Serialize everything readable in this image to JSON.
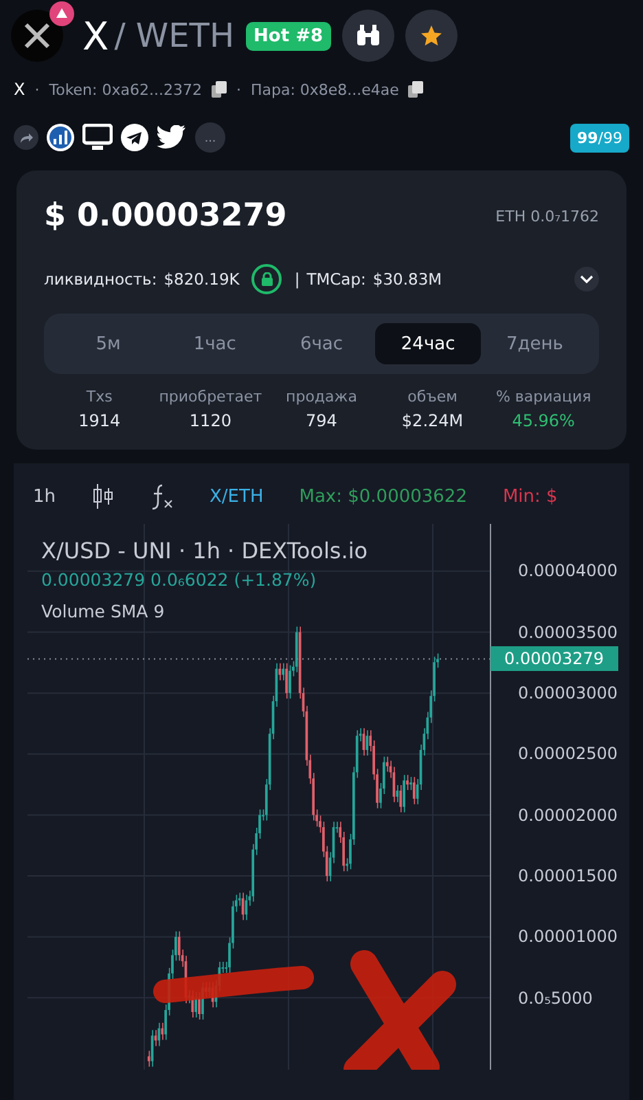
{
  "header": {
    "base": "X",
    "quote": "/ WETH",
    "hot": "Hot #8"
  },
  "addresses": {
    "symbol": "X",
    "dot": "·",
    "token": "Token: 0xa62...2372",
    "pair": "Пара: 0x8e8...e4ae"
  },
  "links": {
    "more": "...",
    "score": "99",
    "score_total": "/99"
  },
  "price": {
    "usd": "$ 0.00003279",
    "eth": "ETH 0.0₇1762"
  },
  "liquidity": {
    "label": "ликвидность:",
    "value": "$820.19K",
    "locked": true,
    "separator": "|",
    "mcap_label": "TMCap:",
    "mcap_value": "$30.83M"
  },
  "tabs": [
    {
      "label": "5м",
      "selected": false
    },
    {
      "label": "1час",
      "selected": false
    },
    {
      "label": "6час",
      "selected": false
    },
    {
      "label": "24час",
      "selected": true
    },
    {
      "label": "7день",
      "selected": false
    }
  ],
  "stats": [
    {
      "label": "Txs",
      "value": "1914",
      "color": "#e6e8ee"
    },
    {
      "label": "приобретает",
      "value": "1120",
      "color": "#e6e8ee"
    },
    {
      "label": "продажа",
      "value": "794",
      "color": "#e6e8ee"
    },
    {
      "label": "объем",
      "value": "$2.24M",
      "color": "#e6e8ee"
    },
    {
      "label": "% вариация",
      "value": "45.96%",
      "color": "#2fbf71"
    }
  ],
  "chart_toolbar": {
    "interval": "1h",
    "pair": "X/ETH",
    "max": "Max: $0.00003622",
    "min": "Min: $"
  },
  "chart": {
    "title": "X/USD - UNI · 1h · DEXTools.io",
    "quote": "0.00003279 0.0₆6022 (+1.87%)",
    "indicator": "Volume SMA 9",
    "last_label": "0.00003279",
    "y_labels": [
      "0.00004000",
      "0.00003500",
      "0.00003000",
      "0.00002500",
      "0.00002000",
      "0.00001500",
      "0.00001000",
      "0.0₅5000"
    ]
  }
}
